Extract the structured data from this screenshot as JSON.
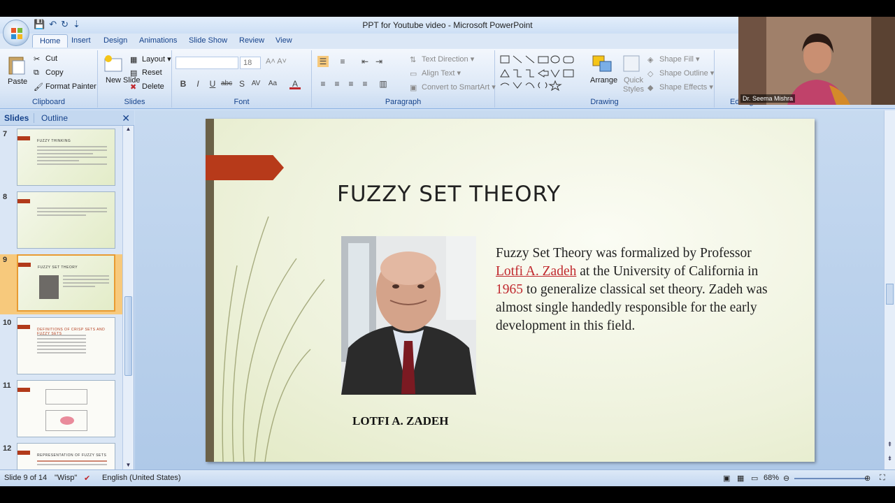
{
  "window": {
    "title": "PPT for Youtube video - Microsoft PowerPoint"
  },
  "tabs": [
    "Home",
    "Insert",
    "Design",
    "Animations",
    "Slide Show",
    "Review",
    "View"
  ],
  "ribbon": {
    "clipboard": {
      "label": "Clipboard",
      "paste": "Paste",
      "cut": "Cut",
      "copy": "Copy",
      "format_painter": "Format Painter"
    },
    "slides": {
      "label": "Slides",
      "new_slide": "New Slide",
      "layout": "Layout",
      "reset": "Reset",
      "delete": "Delete"
    },
    "font": {
      "label": "Font",
      "size": "18"
    },
    "paragraph": {
      "label": "Paragraph",
      "text_direction": "Text Direction",
      "align_text": "Align Text",
      "convert": "Convert to SmartArt"
    },
    "drawing": {
      "label": "Drawing",
      "arrange": "Arrange",
      "quick_styles": "Quick Styles",
      "shape_fill": "Shape Fill",
      "shape_outline": "Shape Outline",
      "shape_effects": "Shape Effects"
    },
    "editing": {
      "label": "Editing"
    }
  },
  "pane": {
    "tab_slides": "Slides",
    "tab_outline": "Outline",
    "thumbs": [
      {
        "num": "7",
        "title": "FUZZY THINKING"
      },
      {
        "num": "8",
        "title": ""
      },
      {
        "num": "9",
        "title": "FUZZY SET THEORY"
      },
      {
        "num": "10",
        "title": "DEFINITIONS OF CRISP SETS AND FUZZY SETS"
      },
      {
        "num": "11",
        "title": ""
      },
      {
        "num": "12",
        "title": "REPRESENTATION OF FUZZY SETS"
      }
    ]
  },
  "slide": {
    "title": "FUZZY SET THEORY",
    "body_1": "Fuzzy Set Theory was formalized  by Professor ",
    "body_name": "Lotfi A. Zadeh",
    "body_2": " at the University of California in ",
    "body_year": "1965",
    "body_3": " to generalize classical set theory.  Zadeh was almost single handedly responsible for the early  development in this field.",
    "caption": "LOTFI A. ZADEH"
  },
  "status": {
    "slide": "Slide 9 of 14",
    "theme": "\"Wisp\"",
    "language": "English (United States)",
    "zoom": "68%"
  },
  "webcam": {
    "name": "Dr. Seema Mishra"
  }
}
